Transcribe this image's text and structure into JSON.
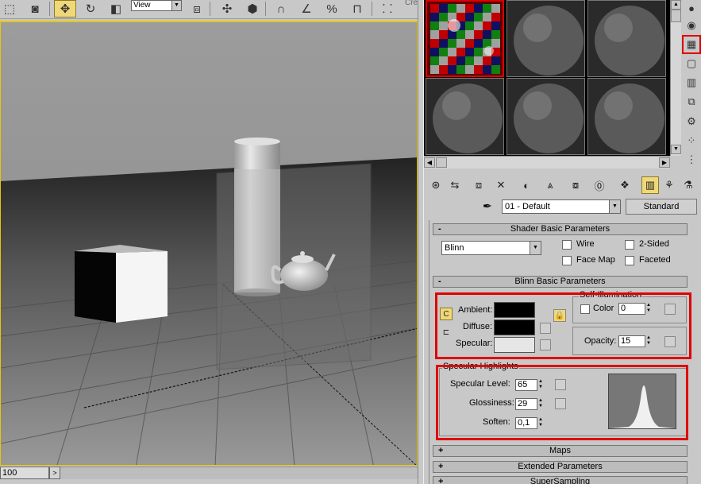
{
  "toolbar": {
    "view_value": "View",
    "cre_text": "Cre"
  },
  "timeline": {
    "frame_value": "100",
    "next_glyph": ">"
  },
  "material_editor": {
    "material_name": "01 - Default",
    "material_type": "Standard"
  },
  "shader_basic": {
    "title": "Shader Basic Parameters",
    "collapse_sign": "-",
    "shader": "Blinn",
    "wire": "Wire",
    "two_sided": "2-Sided",
    "face_map": "Face Map",
    "faceted": "Faceted"
  },
  "blinn_basic": {
    "title": "Blinn Basic Parameters",
    "collapse_sign": "-",
    "ambient": "Ambient:",
    "diffuse": "Diffuse:",
    "specular": "Specular:",
    "self_illum_title": "Self-Illumination",
    "color_label": "Color",
    "color_value": "0",
    "opacity_label": "Opacity:",
    "opacity_value": "15",
    "colors": {
      "ambient": "#000000",
      "diffuse": "#000000",
      "specular": "#e6e6e6"
    }
  },
  "specular_highlights": {
    "title": "Specular Highlights",
    "level_label": "Specular Level:",
    "level_value": "65",
    "gloss_label": "Glossiness:",
    "gloss_value": "29",
    "soften_label": "Soften:",
    "soften_value": "0,1"
  },
  "rollouts": [
    {
      "sign": "+",
      "title": "Maps"
    },
    {
      "sign": "+",
      "title": "Extended Parameters"
    },
    {
      "sign": "+",
      "title": "SuperSampling"
    }
  ],
  "accent_colors": {
    "highlight_box": "#e00000",
    "active_viewport": "#e6c800",
    "active_button": "#f0d878"
  }
}
